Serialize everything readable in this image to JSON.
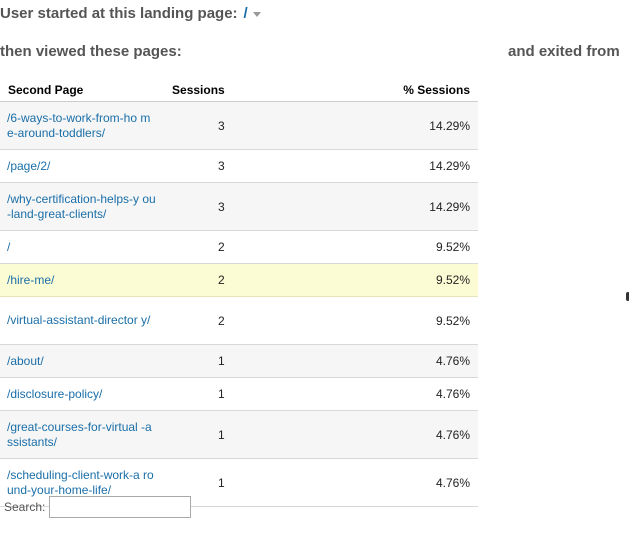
{
  "landing": {
    "label": "User started at this landing page:",
    "value": "/"
  },
  "viewed_label": "then viewed these pages:",
  "exited_label": "and exited from",
  "table": {
    "headers": [
      "Second Page",
      "Sessions",
      "% Sessions"
    ],
    "rows": [
      {
        "page": "/6-ways-to-work-from-ho me-around-toddlers/",
        "sessions": "3",
        "pct": "14.29%"
      },
      {
        "page": "/page/2/",
        "sessions": "3",
        "pct": "14.29%"
      },
      {
        "page": "/why-certification-helps-y ou-land-great-clients/",
        "sessions": "3",
        "pct": "14.29%"
      },
      {
        "page": "/",
        "sessions": "2",
        "pct": "9.52%"
      },
      {
        "page": "/hire-me/",
        "sessions": "2",
        "pct": "9.52%"
      },
      {
        "page": "/virtual-assistant-director y/",
        "sessions": "2",
        "pct": "9.52%"
      },
      {
        "page": "/about/",
        "sessions": "1",
        "pct": "4.76%"
      },
      {
        "page": "/disclosure-policy/",
        "sessions": "1",
        "pct": "4.76%"
      },
      {
        "page": "/great-courses-for-virtual -assistants/",
        "sessions": "1",
        "pct": "4.76%"
      },
      {
        "page": "/scheduling-client-work-a round-your-home-life/",
        "sessions": "1",
        "pct": "4.76%"
      }
    ]
  },
  "search": {
    "label": "Search:",
    "value": ""
  },
  "colors": {
    "link": "#1a6ea8",
    "highlight_row": "#fcfcd4",
    "heading": "#555555"
  }
}
